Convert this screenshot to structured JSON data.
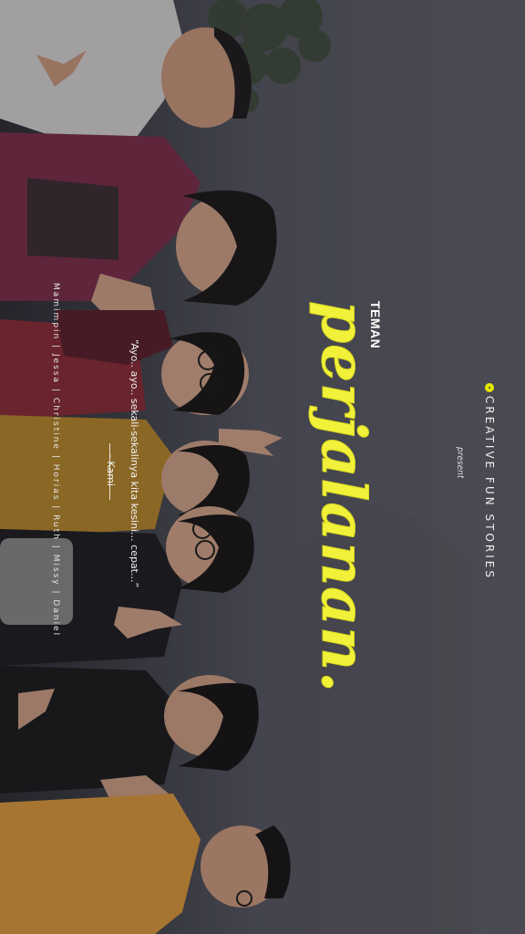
{
  "brand": {
    "name": "CREATIVE FUN STORIES",
    "logo_icon": "circle-logo-icon",
    "present_label": "present"
  },
  "title": {
    "small": "TEMAN",
    "main": "perjalanan."
  },
  "quote": {
    "text": "“Ayo.. ayo.. sekali-sekalinya kita kesini... cepat...”",
    "signature": "- Kami"
  },
  "credits": {
    "names": "Mamimpin | Jessa | Christine | Horias | Ruth | Missy | Daniel"
  },
  "colors": {
    "accent": "#f1f13a",
    "text": "#ffffff",
    "overlay": "#3b3c46"
  }
}
